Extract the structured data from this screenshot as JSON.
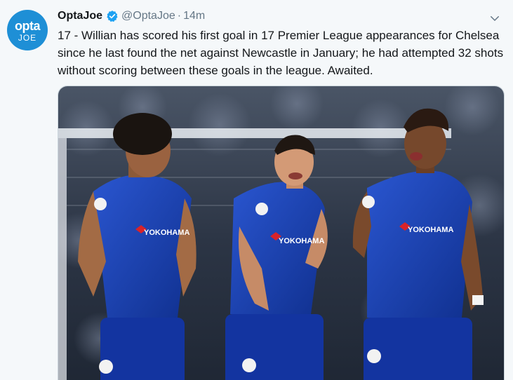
{
  "tweet": {
    "logo_line1": "opta",
    "logo_line2": "JOE",
    "display_name": "OptaJoe",
    "handle": "@OptaJoe",
    "separator": "·",
    "time": "14m",
    "text": "17 - Willian has scored his first goal in 17 Premier League appearances for Chelsea since he last found the net against Newcastle in January; he had attempted 32 shots without scoring between these goals in the league. Awaited.",
    "media": {
      "sponsor_text": "YOKOHAMA",
      "colors": {
        "kit_blue": "#1a3fae",
        "crowd": "#2c3545",
        "accent": "#d8232a"
      }
    }
  }
}
